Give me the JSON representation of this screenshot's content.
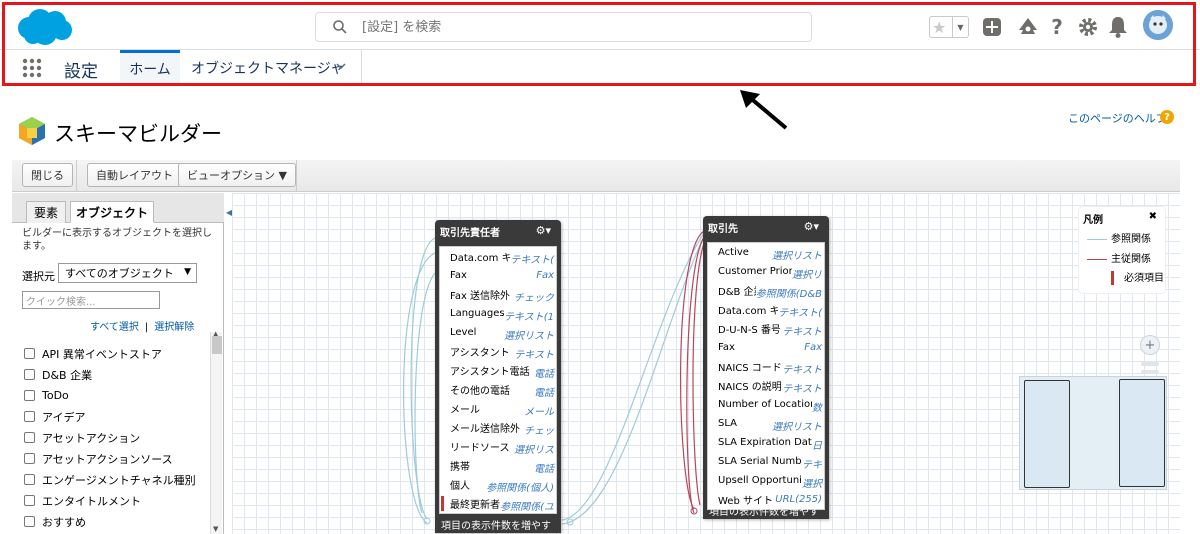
{
  "header": {
    "search_placeholder": "[設定] を検索",
    "app_name": "設定",
    "tabs": [
      {
        "label": "ホーム",
        "active": true
      },
      {
        "label": "オブジェクトマネージャ",
        "active": false
      }
    ]
  },
  "page": {
    "title": "スキーマビルダー",
    "help_link": "このページのヘルプ",
    "help_icon": "?"
  },
  "toolbar": {
    "close_label": "閉じる",
    "auto_layout_label": "自動レイアウト",
    "view_options_label": "ビューオプション ▼"
  },
  "left_panel": {
    "tabs": [
      {
        "label": "要素",
        "active": false
      },
      {
        "label": "オブジェクト",
        "active": true
      }
    ],
    "description": "ビルダーに表示するオブジェクトを選択します。",
    "from_label": "選択元",
    "from_value": "すべてのオブジェクト",
    "quick_search_placeholder": "クイック検索...",
    "select_all": "すべて選択",
    "deselect_all": "選択解除",
    "objects": [
      "API 異常イベントストア",
      "D&B 企業",
      "ToDo",
      "アイデア",
      "アセットアクション",
      "アセットアクションソース",
      "エンゲージメントチャネル種別",
      "エンタイトルメント",
      "おすすめ"
    ]
  },
  "canvas": {
    "objects": [
      {
        "title": "取引先責任者",
        "footer": "項目の表示件数を増やす",
        "fields": [
          {
            "name": "Data.com キー",
            "type": "テキスト(",
            "required": false
          },
          {
            "name": "Fax",
            "type": "Fax",
            "required": false
          },
          {
            "name": "Fax 送信除外",
            "type": "チェック",
            "required": false
          },
          {
            "name": "Languages",
            "type": "テキスト(1",
            "required": false
          },
          {
            "name": "Level",
            "type": "選択リスト",
            "required": false
          },
          {
            "name": "アシスタント",
            "type": "テキスト",
            "required": false
          },
          {
            "name": "アシスタント電話",
            "type": "電話",
            "required": false
          },
          {
            "name": "その他の電話",
            "type": "電話",
            "required": false
          },
          {
            "name": "メール",
            "type": "メール",
            "required": false
          },
          {
            "name": "メール送信除外",
            "type": "チェッ",
            "required": false
          },
          {
            "name": "リードソース",
            "type": "選択リス",
            "required": false
          },
          {
            "name": "携帯",
            "type": "電話",
            "required": false
          },
          {
            "name": "個人",
            "type": "参照関係(個人)",
            "required": false
          },
          {
            "name": "最終更新者",
            "type": "参照関係(ユ",
            "required": true
          }
        ]
      },
      {
        "title": "取引先",
        "footer": "項目の表示件数を増やす",
        "fields": [
          {
            "name": "Active",
            "type": "選択リスト",
            "required": false
          },
          {
            "name": "Customer Priority",
            "type": "選択リ",
            "required": false
          },
          {
            "name": "D&B 企業",
            "type": "参照関係(D&B",
            "required": false
          },
          {
            "name": "Data.com キー",
            "type": "テキスト(",
            "required": false
          },
          {
            "name": "D-U-N-S 番号",
            "type": "テキスト",
            "required": false
          },
          {
            "name": "Fax",
            "type": "Fax",
            "required": false
          },
          {
            "name": "NAICS コード",
            "type": "テキスト",
            "required": false
          },
          {
            "name": "NAICS の説明",
            "type": "テキスト",
            "required": false
          },
          {
            "name": "Number of Locations",
            "type": "数",
            "required": false
          },
          {
            "name": "SLA",
            "type": "選択リスト",
            "required": false
          },
          {
            "name": "SLA Expiration Date",
            "type": "日",
            "required": false
          },
          {
            "name": "SLA Serial Number",
            "type": "テキ",
            "required": false
          },
          {
            "name": "Upsell Opportunity",
            "type": "選択",
            "required": false
          },
          {
            "name": "Web サイト",
            "type": "URL(255)",
            "required": false
          }
        ]
      }
    ],
    "legend": {
      "title": "凡例",
      "close": "✖",
      "items": [
        "参照関係",
        "主従関係",
        "必須項目"
      ]
    },
    "zoom_in": "+"
  },
  "colors": {
    "highlight_box": "#e4161a",
    "lookup_line": "#9ecbd9",
    "master_detail_line": "#b5475c",
    "required_marker": "#c23934",
    "brand": "#00a1e0"
  }
}
